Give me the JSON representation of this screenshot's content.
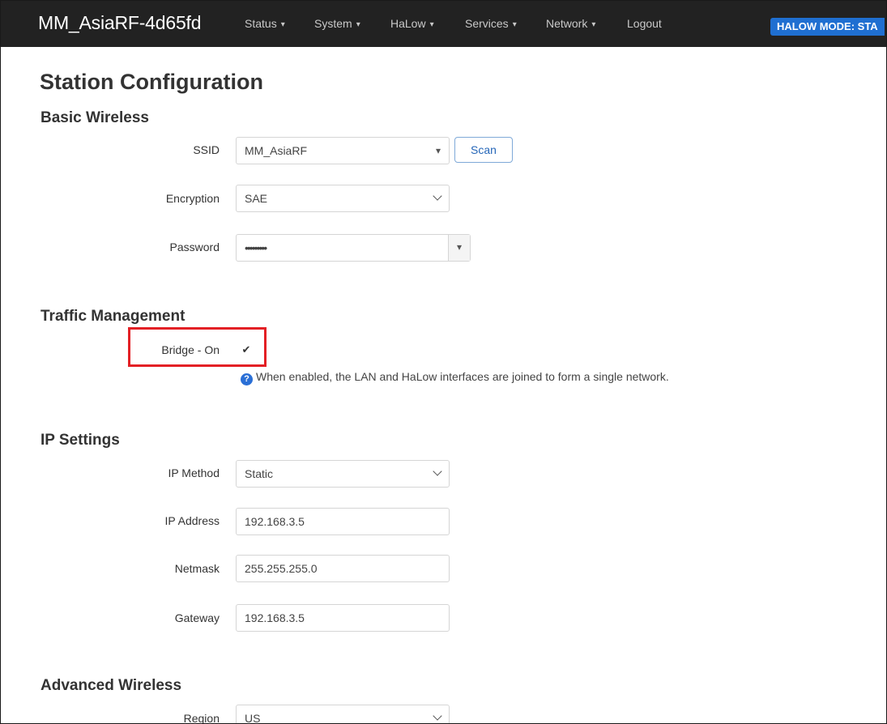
{
  "navbar": {
    "brand": "MM_AsiaRF-4d65fd",
    "menus": [
      "Status",
      "System",
      "HaLow",
      "Services",
      "Network"
    ],
    "logout": "Logout",
    "mode_badge": "HALOW MODE: STA"
  },
  "page_title": "Station Configuration",
  "basic_wireless": {
    "title": "Basic Wireless",
    "ssid": {
      "label": "SSID",
      "value": "MM_AsiaRF"
    },
    "scan_label": "Scan",
    "encryption": {
      "label": "Encryption",
      "value": "SAE"
    },
    "password": {
      "label": "Password",
      "value": "•••••••••"
    }
  },
  "traffic": {
    "title": "Traffic Management",
    "bridge": {
      "label": "Bridge - On",
      "checked": true
    },
    "help": "When enabled, the LAN and HaLow interfaces are joined to form a single network."
  },
  "ip_settings": {
    "title": "IP Settings",
    "method": {
      "label": "IP Method",
      "value": "Static"
    },
    "address": {
      "label": "IP Address",
      "value": "192.168.3.5"
    },
    "netmask": {
      "label": "Netmask",
      "value": "255.255.255.0"
    },
    "gateway": {
      "label": "Gateway",
      "value": "192.168.3.5"
    }
  },
  "advanced": {
    "title": "Advanced Wireless",
    "region": {
      "label": "Region",
      "value": "US"
    }
  },
  "colors": {
    "navbar": "#222222",
    "badge": "#1f6fd1",
    "highlight": "#e32025",
    "help_icon": "#2a6fd6"
  },
  "icons": {
    "dropdown": "caret-down",
    "select": "chevron-down",
    "help": "question-circle",
    "check": "check-mark"
  }
}
